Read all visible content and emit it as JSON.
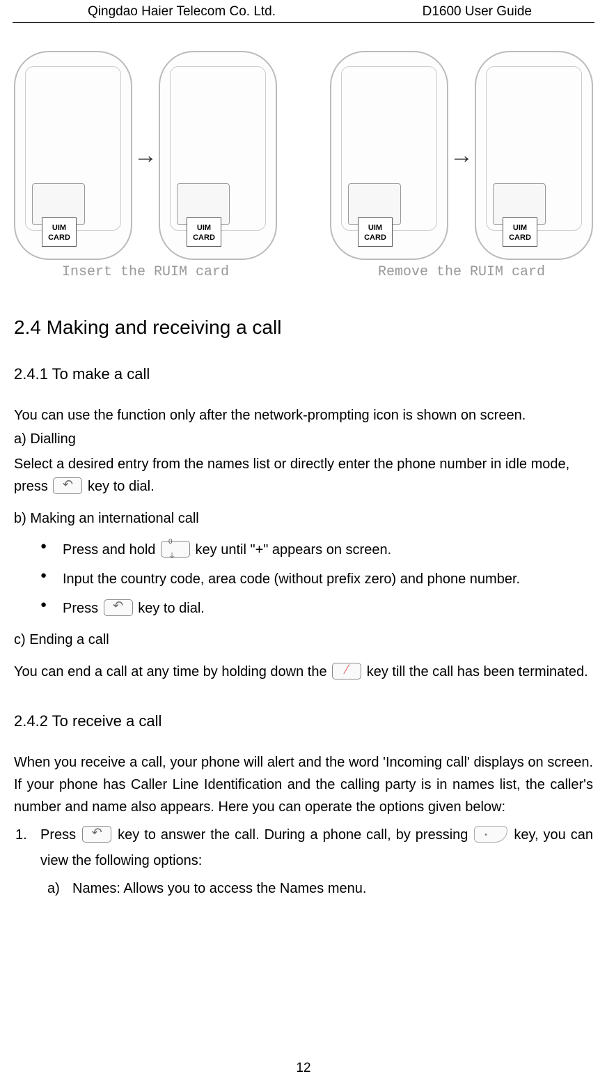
{
  "header": {
    "left": "Qingdao Haier Telecom Co. Ltd.",
    "right": "D1600 User Guide"
  },
  "figures": {
    "card_label": "UIM CARD",
    "caption_insert": "Insert the RUIM card",
    "caption_remove": "Remove the RUIM card"
  },
  "section_2_4": {
    "heading": "2.4 Making and receiving a call",
    "sub_2_4_1": {
      "heading": "2.4.1 To make a call",
      "intro": "You can use the function only after the network-prompting icon is shown on screen.",
      "a_label": "a) Dialling",
      "a_text_before": "Select a desired entry from the names list or directly enter the phone number in idle mode, press ",
      "a_text_after": " key to dial.",
      "b_label": "b) Making an international call",
      "b_bullets": {
        "b1_before": "Press and hold ",
        "b1_after": " key until \"+\" appears on screen.",
        "b2": "Input the country code, area code (without prefix zero) and phone number.",
        "b3_before": "Press ",
        "b3_after": " key to dial."
      },
      "c_label": "c) Ending a call",
      "c_text_before": "You can end a call at any time by holding down the ",
      "c_text_after": " key till the call has been terminated."
    },
    "sub_2_4_2": {
      "heading": "2.4.2 To receive a call",
      "intro": "When you receive a call, your phone will alert and the word 'Incoming call' displays on screen. If your phone has Caller Line Identification and the calling party is in names list, the caller's number and name also appears. Here you can operate the options given below:",
      "item1_before": "Press ",
      "item1_mid": " key to answer the call. During a phone call, by pressing ",
      "item1_after": " key, you can view the following options:",
      "item1a": "Names: Allows you to access the Names menu.",
      "num1": "1.",
      "alpha_a": "a)"
    }
  },
  "page_number": "12"
}
